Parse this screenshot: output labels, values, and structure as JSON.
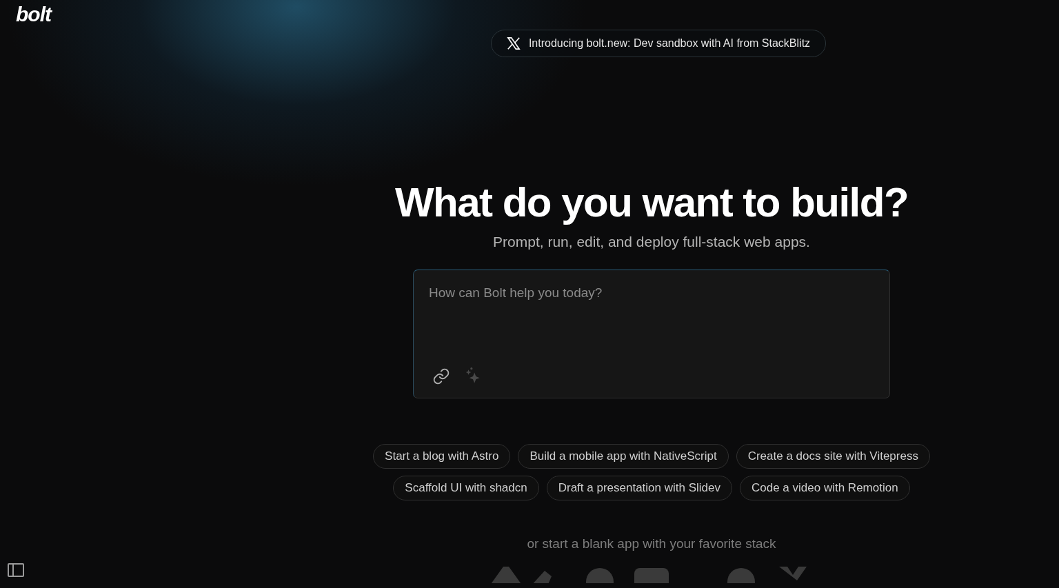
{
  "logo": "bolt",
  "announcement": {
    "text": "Introducing bolt.new: Dev sandbox with AI from StackBlitz"
  },
  "heading": "What do you want to build?",
  "subtitle": "Prompt, run, edit, and deploy full-stack web apps.",
  "prompt": {
    "placeholder": "How can Bolt help you today?"
  },
  "suggestion_rows": [
    [
      "Start a blog with Astro",
      "Build a mobile app with NativeScript",
      "Create a docs site with Vitepress"
    ],
    [
      "Scaffold UI with shadcn",
      "Draft a presentation with Slidev",
      "Code a video with Remotion"
    ]
  ],
  "stack_prompt": "or start a blank app with your favorite stack"
}
